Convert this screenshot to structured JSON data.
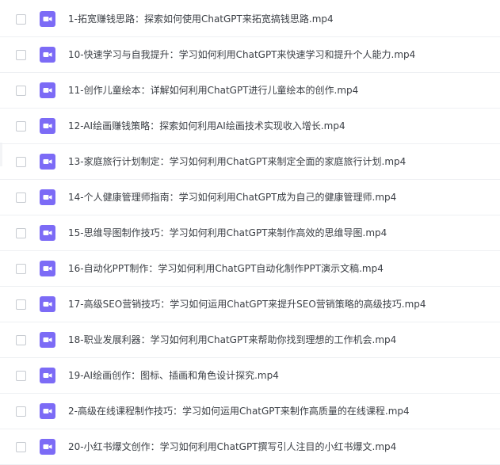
{
  "colors": {
    "accent": "#7c6bf6",
    "text": "#3b3f45",
    "divider": "#eef0f3"
  },
  "file_list": {
    "icon": "video-file-icon",
    "items": [
      {
        "name": "1-拓宽赚钱思路：探索如何使用ChatGPT来拓宽搞钱思路.mp4"
      },
      {
        "name": "10-快速学习与自我提升：学习如何利用ChatGPT来快速学习和提升个人能力.mp4"
      },
      {
        "name": "11-创作儿童绘本：详解如何利用ChatGPT进行儿童绘本的创作.mp4"
      },
      {
        "name": "12-AI绘画赚钱策略：探索如何利用AI绘画技术实现收入增长.mp4"
      },
      {
        "name": "13-家庭旅行计划制定：学习如何利用ChatGPT来制定全面的家庭旅行计划.mp4"
      },
      {
        "name": "14-个人健康管理师指南：学习如何利用ChatGPT成为自己的健康管理师.mp4"
      },
      {
        "name": "15-思维导图制作技巧：学习如何利用ChatGPT来制作高效的思维导图.mp4"
      },
      {
        "name": "16-自动化PPT制作：学习如何利用ChatGPT自动化制作PPT演示文稿.mp4"
      },
      {
        "name": "17-高级SEO营销技巧：学习如何运用ChatGPT来提升SEO营销策略的高级技巧.mp4"
      },
      {
        "name": "18-职业发展利器：学习如何利用ChatGPT来帮助你找到理想的工作机会.mp4"
      },
      {
        "name": "19-AI绘画创作：图标、插画和角色设计探究.mp4"
      },
      {
        "name": "2-高级在线课程制作技巧：学习如何运用ChatGPT来制作高质量的在线课程.mp4"
      },
      {
        "name": "20-小红书爆文创作：学习如何利用ChatGPT撰写引人注目的小红书爆文.mp4"
      }
    ]
  }
}
